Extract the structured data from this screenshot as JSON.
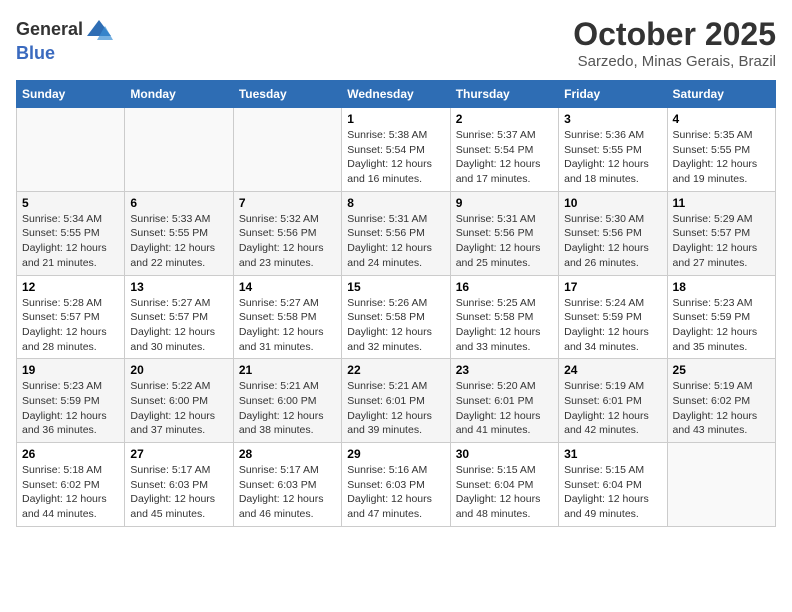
{
  "logo": {
    "general": "General",
    "blue": "Blue"
  },
  "title": "October 2025",
  "location": "Sarzedo, Minas Gerais, Brazil",
  "weekdays": [
    "Sunday",
    "Monday",
    "Tuesday",
    "Wednesday",
    "Thursday",
    "Friday",
    "Saturday"
  ],
  "weeks": [
    [
      {
        "day": "",
        "info": ""
      },
      {
        "day": "",
        "info": ""
      },
      {
        "day": "",
        "info": ""
      },
      {
        "day": "1",
        "info": "Sunrise: 5:38 AM\nSunset: 5:54 PM\nDaylight: 12 hours\nand 16 minutes."
      },
      {
        "day": "2",
        "info": "Sunrise: 5:37 AM\nSunset: 5:54 PM\nDaylight: 12 hours\nand 17 minutes."
      },
      {
        "day": "3",
        "info": "Sunrise: 5:36 AM\nSunset: 5:55 PM\nDaylight: 12 hours\nand 18 minutes."
      },
      {
        "day": "4",
        "info": "Sunrise: 5:35 AM\nSunset: 5:55 PM\nDaylight: 12 hours\nand 19 minutes."
      }
    ],
    [
      {
        "day": "5",
        "info": "Sunrise: 5:34 AM\nSunset: 5:55 PM\nDaylight: 12 hours\nand 21 minutes."
      },
      {
        "day": "6",
        "info": "Sunrise: 5:33 AM\nSunset: 5:55 PM\nDaylight: 12 hours\nand 22 minutes."
      },
      {
        "day": "7",
        "info": "Sunrise: 5:32 AM\nSunset: 5:56 PM\nDaylight: 12 hours\nand 23 minutes."
      },
      {
        "day": "8",
        "info": "Sunrise: 5:31 AM\nSunset: 5:56 PM\nDaylight: 12 hours\nand 24 minutes."
      },
      {
        "day": "9",
        "info": "Sunrise: 5:31 AM\nSunset: 5:56 PM\nDaylight: 12 hours\nand 25 minutes."
      },
      {
        "day": "10",
        "info": "Sunrise: 5:30 AM\nSunset: 5:56 PM\nDaylight: 12 hours\nand 26 minutes."
      },
      {
        "day": "11",
        "info": "Sunrise: 5:29 AM\nSunset: 5:57 PM\nDaylight: 12 hours\nand 27 minutes."
      }
    ],
    [
      {
        "day": "12",
        "info": "Sunrise: 5:28 AM\nSunset: 5:57 PM\nDaylight: 12 hours\nand 28 minutes."
      },
      {
        "day": "13",
        "info": "Sunrise: 5:27 AM\nSunset: 5:57 PM\nDaylight: 12 hours\nand 30 minutes."
      },
      {
        "day": "14",
        "info": "Sunrise: 5:27 AM\nSunset: 5:58 PM\nDaylight: 12 hours\nand 31 minutes."
      },
      {
        "day": "15",
        "info": "Sunrise: 5:26 AM\nSunset: 5:58 PM\nDaylight: 12 hours\nand 32 minutes."
      },
      {
        "day": "16",
        "info": "Sunrise: 5:25 AM\nSunset: 5:58 PM\nDaylight: 12 hours\nand 33 minutes."
      },
      {
        "day": "17",
        "info": "Sunrise: 5:24 AM\nSunset: 5:59 PM\nDaylight: 12 hours\nand 34 minutes."
      },
      {
        "day": "18",
        "info": "Sunrise: 5:23 AM\nSunset: 5:59 PM\nDaylight: 12 hours\nand 35 minutes."
      }
    ],
    [
      {
        "day": "19",
        "info": "Sunrise: 5:23 AM\nSunset: 5:59 PM\nDaylight: 12 hours\nand 36 minutes."
      },
      {
        "day": "20",
        "info": "Sunrise: 5:22 AM\nSunset: 6:00 PM\nDaylight: 12 hours\nand 37 minutes."
      },
      {
        "day": "21",
        "info": "Sunrise: 5:21 AM\nSunset: 6:00 PM\nDaylight: 12 hours\nand 38 minutes."
      },
      {
        "day": "22",
        "info": "Sunrise: 5:21 AM\nSunset: 6:01 PM\nDaylight: 12 hours\nand 39 minutes."
      },
      {
        "day": "23",
        "info": "Sunrise: 5:20 AM\nSunset: 6:01 PM\nDaylight: 12 hours\nand 41 minutes."
      },
      {
        "day": "24",
        "info": "Sunrise: 5:19 AM\nSunset: 6:01 PM\nDaylight: 12 hours\nand 42 minutes."
      },
      {
        "day": "25",
        "info": "Sunrise: 5:19 AM\nSunset: 6:02 PM\nDaylight: 12 hours\nand 43 minutes."
      }
    ],
    [
      {
        "day": "26",
        "info": "Sunrise: 5:18 AM\nSunset: 6:02 PM\nDaylight: 12 hours\nand 44 minutes."
      },
      {
        "day": "27",
        "info": "Sunrise: 5:17 AM\nSunset: 6:03 PM\nDaylight: 12 hours\nand 45 minutes."
      },
      {
        "day": "28",
        "info": "Sunrise: 5:17 AM\nSunset: 6:03 PM\nDaylight: 12 hours\nand 46 minutes."
      },
      {
        "day": "29",
        "info": "Sunrise: 5:16 AM\nSunset: 6:03 PM\nDaylight: 12 hours\nand 47 minutes."
      },
      {
        "day": "30",
        "info": "Sunrise: 5:15 AM\nSunset: 6:04 PM\nDaylight: 12 hours\nand 48 minutes."
      },
      {
        "day": "31",
        "info": "Sunrise: 5:15 AM\nSunset: 6:04 PM\nDaylight: 12 hours\nand 49 minutes."
      },
      {
        "day": "",
        "info": ""
      }
    ]
  ]
}
